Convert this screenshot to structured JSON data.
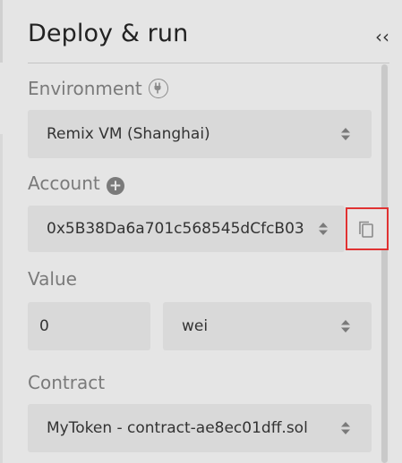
{
  "header": {
    "title": "Deploy & run",
    "collapse_icon": "double-chevron-left-icon",
    "collapse_glyph": "‹‹"
  },
  "environment": {
    "label": "Environment",
    "icon": "plug-icon",
    "selected": "Remix VM (Shanghai)"
  },
  "account": {
    "label": "Account",
    "add_icon": "plus-circle-icon",
    "add_glyph": "+",
    "selected": "0x5B38Da6a701c568545dCfcB03",
    "copy_icon": "copy-icon"
  },
  "value": {
    "label": "Value",
    "amount": "0",
    "unit": "wei"
  },
  "contract": {
    "label": "Contract",
    "selected": "MyToken - contract-ae8ec01dff.sol"
  },
  "colors": {
    "background": "#e5e5e5",
    "field": "#d9d9d9",
    "label": "#7a7a7a",
    "highlight_border": "#e03232"
  }
}
